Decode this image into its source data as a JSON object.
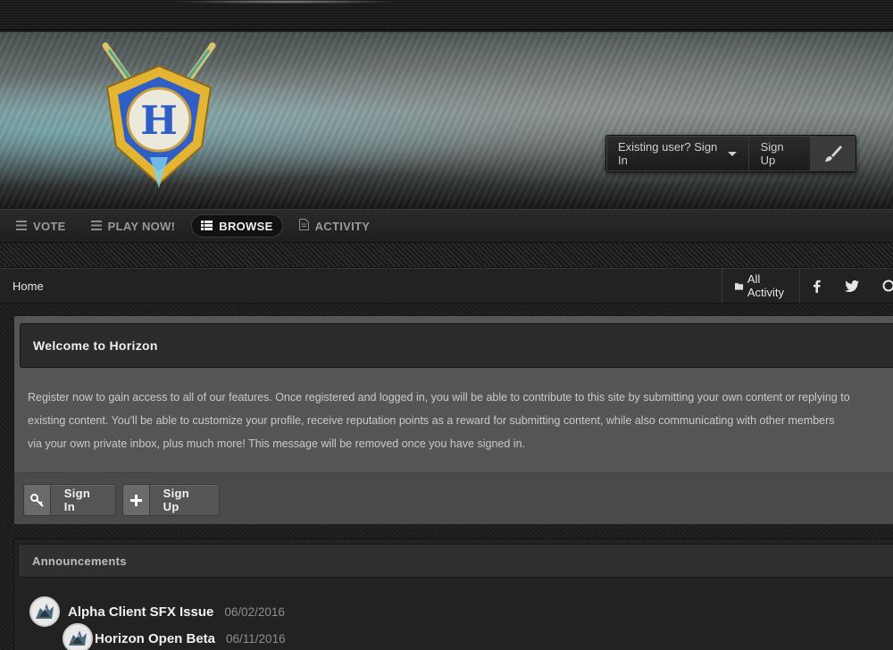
{
  "header": {
    "logo_name": "horizon-shield-logo",
    "logo_letter": "H",
    "userbar": {
      "signin_label": "Existing user? Sign In",
      "signup_label": "Sign Up",
      "theme_icon": "brush-icon"
    }
  },
  "nav": {
    "items": [
      {
        "label": "VOTE",
        "icon": "bars-icon"
      },
      {
        "label": "PLAY NOW!",
        "icon": "bars-icon"
      },
      {
        "label": "BROWSE",
        "icon": "list-icon",
        "active": true
      },
      {
        "label": "ACTIVITY",
        "icon": "document-icon"
      }
    ]
  },
  "breadcrumb": {
    "home": "Home",
    "all_activity": "All Activity"
  },
  "welcome": {
    "title": "Welcome to Horizon",
    "body_line1": "Register now to gain access to all of our features. Once registered and logged in, you will be able to contribute to this site by submitting your own content or replying to",
    "body_line2": "existing content. You'll be able to customize your profile, receive reputation points as a reward for submitting content, while also communicating with other members",
    "body_line3": "via your own private inbox, plus much more! This message will be removed once you have signed in.",
    "signin_button": "Sign In",
    "signup_button": "Sign Up"
  },
  "announcements": {
    "title": "Announcements",
    "items": [
      {
        "title": "Alpha Client SFX Issue",
        "date": "06/02/2016"
      },
      {
        "title": "Horizon Open Beta",
        "date": "06/11/2016"
      }
    ]
  },
  "colors": {
    "accent_gold": "#e3b533",
    "accent_blue": "#2f5fc4",
    "panel_dark": "#2b2b2b"
  }
}
